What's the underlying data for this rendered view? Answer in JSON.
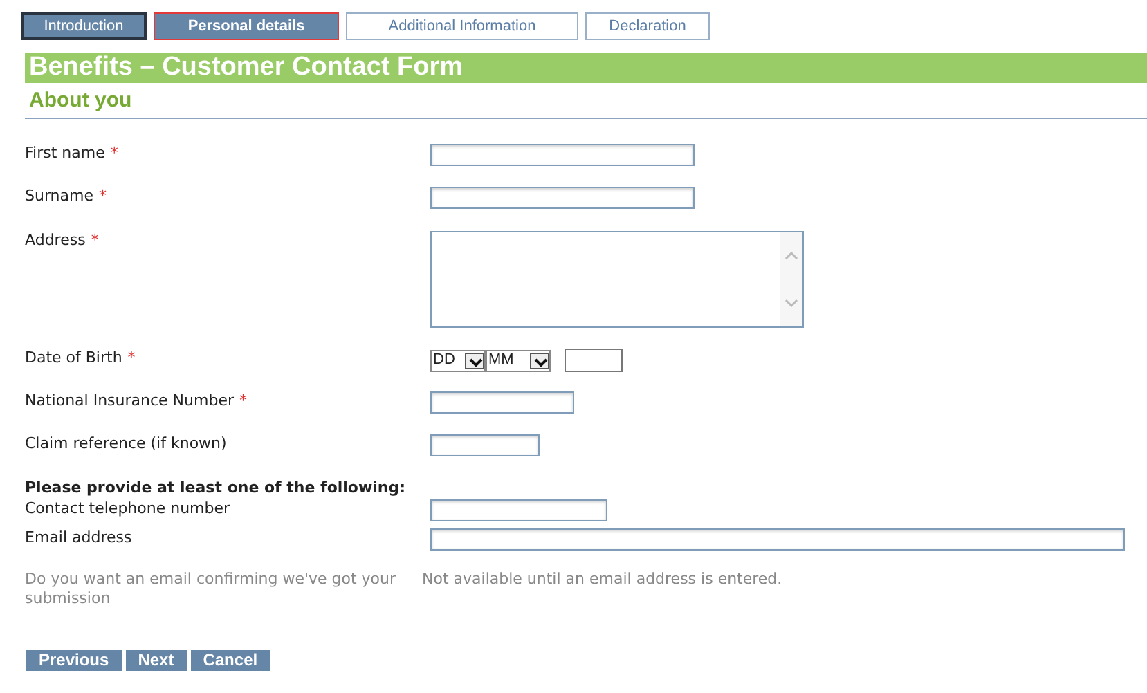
{
  "tabs": [
    {
      "label": "Introduction",
      "selected": false,
      "kind": "completed"
    },
    {
      "label": "Personal details",
      "selected": true,
      "kind": "current"
    },
    {
      "label": "Additional Information",
      "selected": false,
      "kind": "pending"
    },
    {
      "label": "Declaration",
      "selected": false,
      "kind": "pending"
    }
  ],
  "required_marker": "*",
  "title": "Benefits – Customer Contact Form",
  "section": "About you",
  "fields": [
    {
      "kind": "text",
      "label": "First name",
      "required": true
    },
    {
      "kind": "text",
      "label": "Surname",
      "required": true
    },
    {
      "kind": "textarea",
      "label": "Address",
      "required": true
    },
    {
      "kind": "date",
      "label": "Date of Birth",
      "required": true,
      "day": "DD",
      "month": "MM"
    },
    {
      "kind": "text",
      "label": "National Insurance Number",
      "required": true
    },
    {
      "kind": "text",
      "label": "Claim reference (if known)",
      "required": false
    }
  ],
  "contact_heading": "Please provide at least one of the following:",
  "contact_fields": [
    {
      "label": "Contact telephone number"
    },
    {
      "label": "Email address"
    }
  ],
  "confirmation": {
    "label": "Do you want an email confirming we've got your submission",
    "note": "Not available until an email address is entered.",
    "disabled": true
  },
  "buttons": [
    "Previous",
    "Next",
    "Cancel"
  ]
}
